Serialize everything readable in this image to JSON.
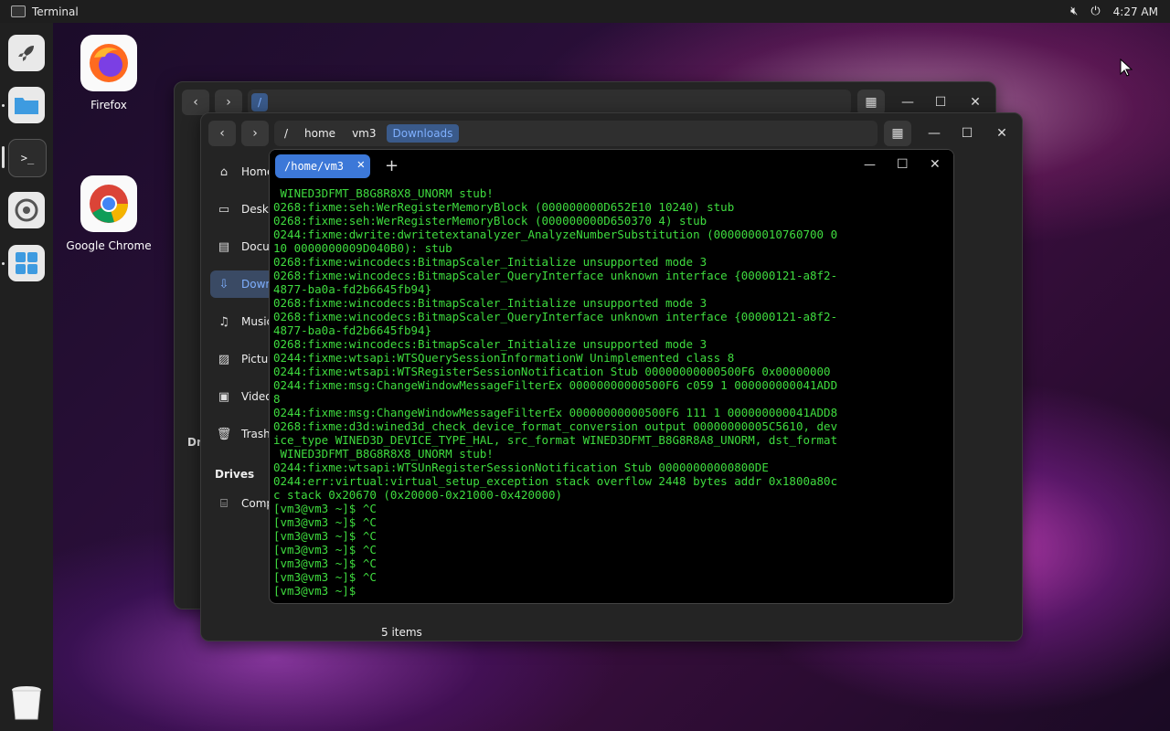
{
  "topbar": {
    "app_title": "Terminal",
    "time": "4:27 AM"
  },
  "desktop": {
    "icons": [
      {
        "label": "Firefox"
      },
      {
        "label": "Google Chrome"
      }
    ]
  },
  "fm_back": {
    "path": "/"
  },
  "fm_front": {
    "crumbs": [
      "/",
      "home",
      "vm3",
      "Downloads"
    ],
    "sidebar": [
      "Home",
      "Deskt",
      "Docu",
      "Down",
      "Music",
      "Pictur",
      "Video",
      "Trash"
    ],
    "drives_heading": "Drives",
    "drive_item": "Comp",
    "status": "5 items"
  },
  "fm_back_side": {
    "drives_heading": "Dr"
  },
  "terminal": {
    "tab_label": "/home/vm3",
    "lines": [
      " WINED3DFMT_B8G8R8X8_UNORM stub!",
      "0268:fixme:seh:WerRegisterMemoryBlock (000000000D652E10 10240) stub",
      "0268:fixme:seh:WerRegisterMemoryBlock (000000000D650370 4) stub",
      "0244:fixme:dwrite:dwritetextanalyzer_AnalyzeNumberSubstitution (0000000010760700 0",
      "10 0000000009D040B0): stub",
      "0268:fixme:wincodecs:BitmapScaler_Initialize unsupported mode 3",
      "0268:fixme:wincodecs:BitmapScaler_QueryInterface unknown interface {00000121-a8f2-",
      "4877-ba0a-fd2b6645fb94}",
      "0268:fixme:wincodecs:BitmapScaler_Initialize unsupported mode 3",
      "0268:fixme:wincodecs:BitmapScaler_QueryInterface unknown interface {00000121-a8f2-",
      "4877-ba0a-fd2b6645fb94}",
      "0268:fixme:wincodecs:BitmapScaler_Initialize unsupported mode 3",
      "0244:fixme:wtsapi:WTSQuerySessionInformationW Unimplemented class 8",
      "0244:fixme:wtsapi:WTSRegisterSessionNotification Stub 00000000000500F6 0x00000000",
      "0244:fixme:msg:ChangeWindowMessageFilterEx 00000000000500F6 c059 1 000000000041ADD",
      "8",
      "0244:fixme:msg:ChangeWindowMessageFilterEx 00000000000500F6 111 1 000000000041ADD8",
      "0268:fixme:d3d:wined3d_check_device_format_conversion output 00000000005C5610, dev",
      "ice_type WINED3D_DEVICE_TYPE_HAL, src_format WINED3DFMT_B8G8R8A8_UNORM, dst_format",
      " WINED3DFMT_B8G8R8X8_UNORM stub!",
      "0244:fixme:wtsapi:WTSUnRegisterSessionNotification Stub 00000000000800DE",
      "0244:err:virtual:virtual_setup_exception stack overflow 2448 bytes addr 0x1800a80c",
      "c stack 0x20670 (0x20000-0x21000-0x420000)",
      "[vm3@vm3 ~]$ ^C",
      "[vm3@vm3 ~]$ ^C",
      "[vm3@vm3 ~]$ ^C",
      "[vm3@vm3 ~]$ ^C",
      "[vm3@vm3 ~]$ ^C",
      "[vm3@vm3 ~]$ ^C",
      "[vm3@vm3 ~]$ "
    ]
  }
}
